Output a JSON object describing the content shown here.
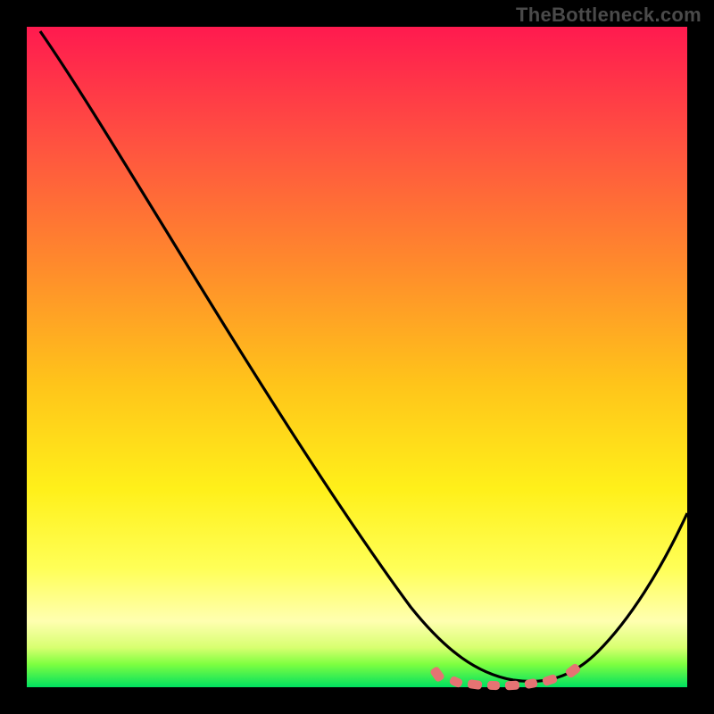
{
  "watermark": "TheBottleneck.com",
  "chart_data": {
    "type": "line",
    "title": "",
    "xlabel": "",
    "ylabel": "",
    "xlim": [
      0,
      100
    ],
    "ylim": [
      0,
      100
    ],
    "grid": false,
    "curve_points": [
      {
        "x": 2,
        "y": 99
      },
      {
        "x": 8,
        "y": 90
      },
      {
        "x": 18,
        "y": 75
      },
      {
        "x": 30,
        "y": 56
      },
      {
        "x": 42,
        "y": 37
      },
      {
        "x": 54,
        "y": 18
      },
      {
        "x": 62,
        "y": 8
      },
      {
        "x": 68,
        "y": 3
      },
      {
        "x": 74,
        "y": 1
      },
      {
        "x": 80,
        "y": 2
      },
      {
        "x": 86,
        "y": 6
      },
      {
        "x": 92,
        "y": 13
      },
      {
        "x": 100,
        "y": 27
      }
    ],
    "optimal_zone": {
      "x_start": 62,
      "x_end": 84,
      "y": 2
    },
    "background_gradient": [
      {
        "pos": 0,
        "color": "#ff1a4f",
        "meaning": "severe-bottleneck"
      },
      {
        "pos": 50,
        "color": "#ffc41a",
        "meaning": "moderate"
      },
      {
        "pos": 85,
        "color": "#ffff57",
        "meaning": "light"
      },
      {
        "pos": 100,
        "color": "#00e060",
        "meaning": "no-bottleneck"
      }
    ]
  }
}
